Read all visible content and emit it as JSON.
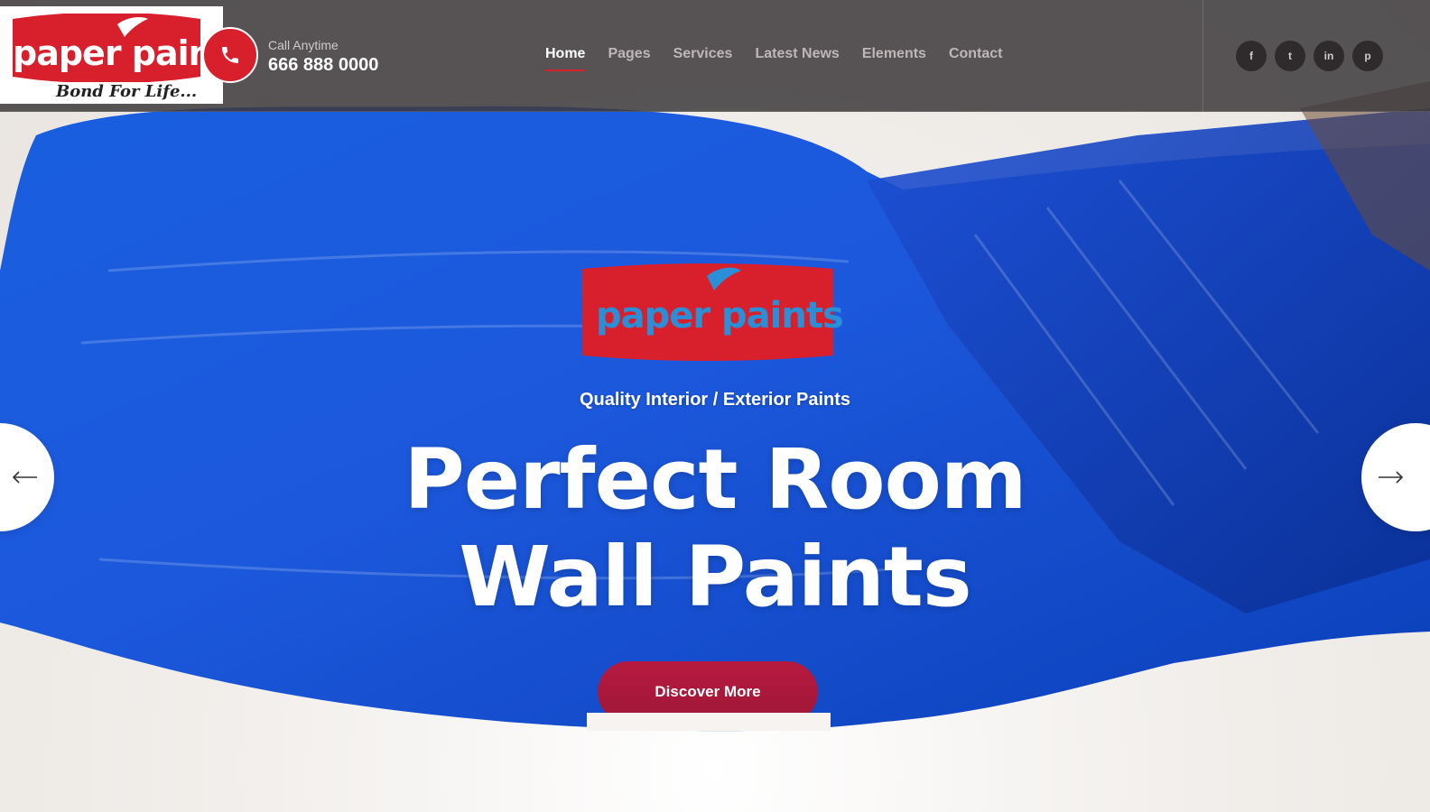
{
  "brand": {
    "name": "paper paints",
    "tagline": "Bond For Life...",
    "accent_red": "#d8202d",
    "paint_blue": "#1652d8"
  },
  "contact": {
    "label": "Call Anytime",
    "phone": "666 888 0000",
    "icon": "phone-icon"
  },
  "nav": {
    "items": [
      {
        "label": "Home",
        "active": true
      },
      {
        "label": "Pages"
      },
      {
        "label": "Services"
      },
      {
        "label": "Latest News"
      },
      {
        "label": "Elements"
      },
      {
        "label": "Contact"
      }
    ]
  },
  "social": [
    {
      "icon": "facebook-icon",
      "glyph": "f"
    },
    {
      "icon": "twitter-icon",
      "glyph": "t"
    },
    {
      "icon": "linkedin-icon",
      "glyph": "in"
    },
    {
      "icon": "pinterest-icon",
      "glyph": "p"
    }
  ],
  "hero": {
    "logo_text": "paper paints",
    "subtitle": "Quality Interior / Exterior Paints",
    "headline_line1": "Perfect Room",
    "headline_line2": "Wall Paints",
    "cta_label": "Discover More",
    "prev_icon": "arrow-left-icon",
    "next_icon": "arrow-right-icon"
  }
}
